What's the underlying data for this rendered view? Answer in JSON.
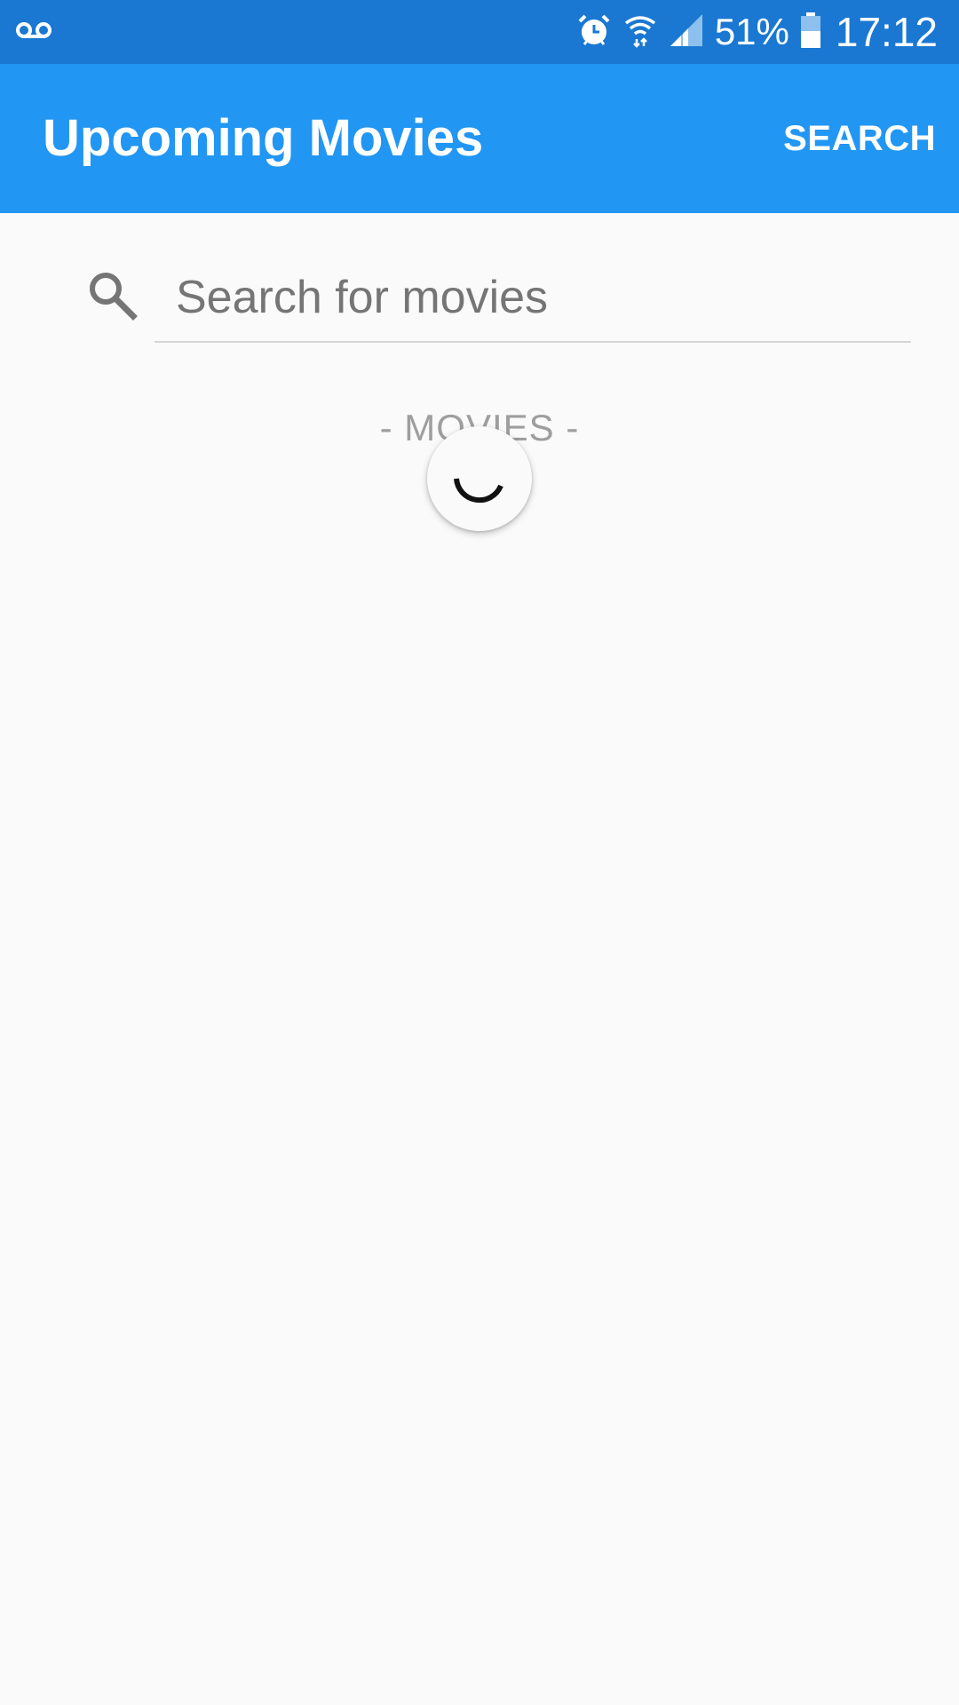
{
  "status_bar": {
    "battery_percent": "51%",
    "time": "17:12",
    "icons": [
      "voicemail-icon",
      "alarm-icon",
      "wifi-icon",
      "signal-icon",
      "battery-icon"
    ]
  },
  "app_bar": {
    "title": "Upcoming Movies",
    "action_label": "SEARCH",
    "color": "#2196f3"
  },
  "search": {
    "placeholder": "Search for movies",
    "value": ""
  },
  "content": {
    "section_label": "- MOVIES -",
    "loading": true
  },
  "colors": {
    "status_bar": "#1a78d2",
    "app_bar": "#2196f3",
    "background": "#fafafa"
  }
}
